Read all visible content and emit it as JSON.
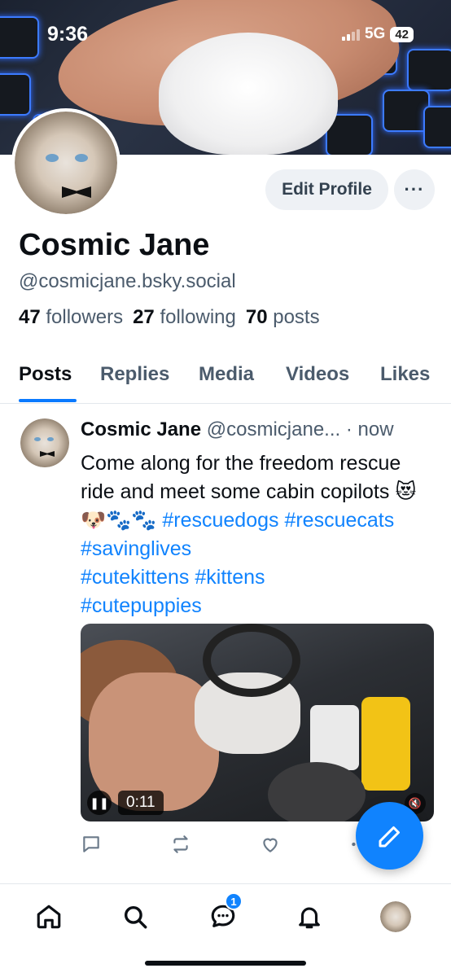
{
  "status_bar": {
    "time": "9:36",
    "network": "5G",
    "battery": "42"
  },
  "profile": {
    "display_name": "Cosmic Jane",
    "handle": "@cosmicjane.bsky.social",
    "edit_label": "Edit Profile",
    "more_label": "···",
    "stats": {
      "followers_count": "47",
      "followers_label": "followers",
      "following_count": "27",
      "following_label": "following",
      "posts_count": "70",
      "posts_label": "posts"
    }
  },
  "tabs": [
    {
      "label": "Posts",
      "active": true
    },
    {
      "label": "Replies",
      "active": false
    },
    {
      "label": "Media",
      "active": false
    },
    {
      "label": "Videos",
      "active": false
    },
    {
      "label": "Likes",
      "active": false
    }
  ],
  "post": {
    "author_name": "Cosmic Jane",
    "author_handle": "@cosmicjane...",
    "time": "· now",
    "text": "Come along for the freedom rescue ride and meet some cabin copilots 😻 🐶🐾🐾",
    "hashtags": [
      "#rescuedogs",
      "#rescuecats",
      "#savinglives",
      "#cutekittens",
      "#kittens",
      "#cutepuppies"
    ],
    "video_time": "0:11"
  },
  "nav": {
    "items": [
      "home-icon",
      "search-icon",
      "chat-icon",
      "bell-icon",
      "profile-avatar"
    ],
    "chat_badge": "1"
  },
  "colors": {
    "accent": "#1083fe",
    "text": "#0b0f14",
    "muted": "#4b5b6c"
  }
}
